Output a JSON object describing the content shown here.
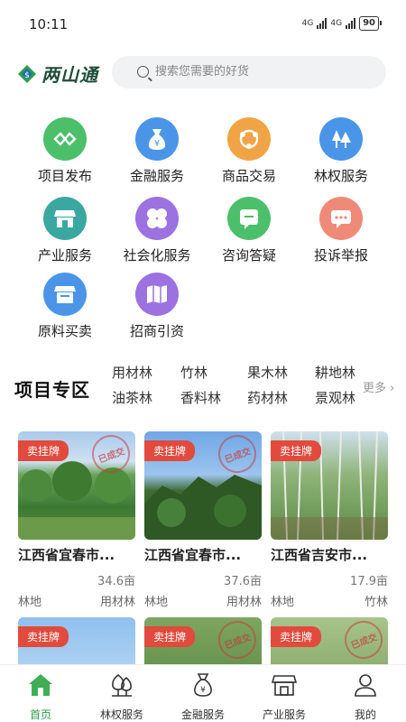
{
  "status_bar": {
    "time": "10:11",
    "network_1": "4G",
    "network_2": "4G",
    "battery": "90"
  },
  "header": {
    "logo_text": "两山通",
    "search_placeholder": "搜索您需要的好货"
  },
  "services": [
    {
      "label": "项目发布",
      "icon": "project-publish-icon",
      "color": "#4cbf6a"
    },
    {
      "label": "金融服务",
      "icon": "money-bag-icon",
      "color": "#4a95e8",
      "glyph": "¥"
    },
    {
      "label": "商品交易",
      "icon": "trade-icon",
      "color": "#f0a445"
    },
    {
      "label": "林权服务",
      "icon": "forest-icon",
      "color": "#4a95e8"
    },
    {
      "label": "产业服务",
      "icon": "store-icon",
      "color": "#3aa8a0"
    },
    {
      "label": "社会化服务",
      "icon": "clover-icon",
      "color": "#9b72e0"
    },
    {
      "label": "咨询答疑",
      "icon": "consult-icon",
      "color": "#4cbf6a"
    },
    {
      "label": "投诉举报",
      "icon": "complaint-icon",
      "color": "#f08a78"
    },
    {
      "label": "原料买卖",
      "icon": "material-icon",
      "color": "#4a95e8"
    },
    {
      "label": "招商引资",
      "icon": "map-icon",
      "color": "#9b72e0"
    }
  ],
  "zone": {
    "title": "项目专区",
    "tags_row1": [
      "用材林",
      "竹林",
      "果木林",
      "耕地林"
    ],
    "tags_row2": [
      "油茶林",
      "香料林",
      "药材林",
      "景观林"
    ],
    "more": "更多"
  },
  "cards": [
    {
      "badge": "卖挂牌",
      "stamp": "已成交",
      "title": "江西省宜春市...",
      "area": "34.6亩",
      "type": "林地",
      "category": "用材林"
    },
    {
      "badge": "卖挂牌",
      "stamp": "已成交",
      "title": "江西省宜春市...",
      "area": "37.6亩",
      "type": "林地",
      "category": "用材林"
    },
    {
      "badge": "卖挂牌",
      "stamp": "",
      "title": "江西省吉安市...",
      "area": "17.9亩",
      "type": "林地",
      "category": "竹林"
    },
    {
      "badge": "卖挂牌",
      "stamp": "",
      "title": "",
      "area": "",
      "type": "",
      "category": ""
    },
    {
      "badge": "卖挂牌",
      "stamp": "已成交",
      "title": "",
      "area": "",
      "type": "",
      "category": ""
    },
    {
      "badge": "卖挂牌",
      "stamp": "已成交",
      "title": "",
      "area": "",
      "type": "",
      "category": ""
    }
  ],
  "bottom_nav": [
    {
      "label": "首页",
      "icon": "home-icon",
      "active": true
    },
    {
      "label": "林权服务",
      "icon": "tree-icon",
      "active": false
    },
    {
      "label": "金融服务",
      "icon": "money-bag-icon",
      "active": false
    },
    {
      "label": "产业服务",
      "icon": "store-icon",
      "active": false
    },
    {
      "label": "我的",
      "icon": "user-icon",
      "active": false
    }
  ],
  "colors": {
    "accent_green": "#2e9e4a",
    "badge_red": "#e14a3d"
  }
}
